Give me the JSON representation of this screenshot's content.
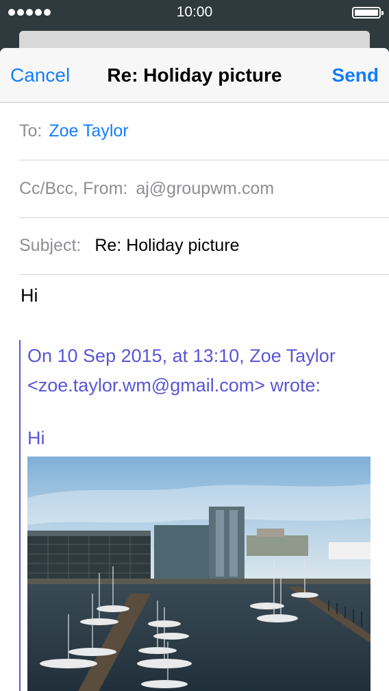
{
  "status_bar": {
    "time": "10:00",
    "signal_dots": 5
  },
  "nav": {
    "cancel_label": "Cancel",
    "title": "Re: Holiday picture",
    "send_label": "Send"
  },
  "fields": {
    "to_label": "To:",
    "to_value": "Zoe Taylor",
    "cc_label": "Cc/Bcc, From:",
    "cc_value": "aj@groupwm.com",
    "subject_label": "Subject:",
    "subject_value": "Re: Holiday picture"
  },
  "body": {
    "greeting": "Hi"
  },
  "quote": {
    "header_line1": "On 10 Sep 2015, at 13:10, Zoe Taylor",
    "header_line2": "<zoe.taylor.wm@gmail.com> wrote:",
    "greeting": "Hi"
  },
  "colors": {
    "accent": "#147efb",
    "quote": "#5856d6",
    "label_gray": "#8e8e93",
    "status_bar": "#2e3a3d"
  }
}
